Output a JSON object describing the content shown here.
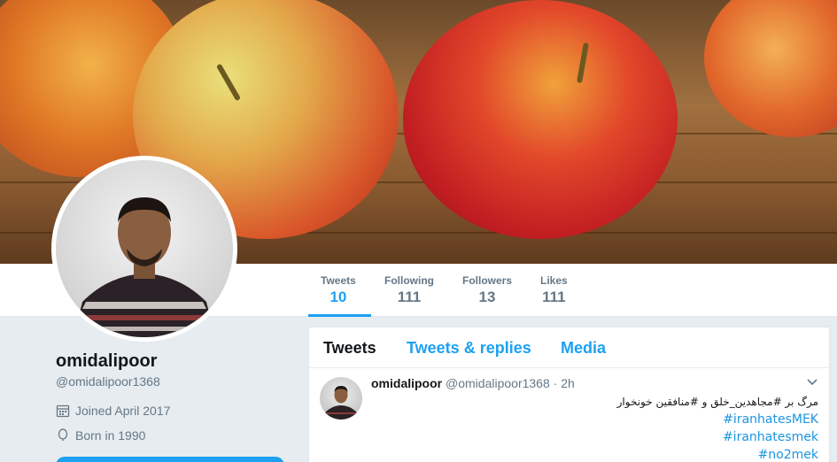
{
  "nav": {
    "tweets_label": "Tweets",
    "tweets_count": "10",
    "following_label": "Following",
    "following_count": "111",
    "followers_label": "Followers",
    "followers_count": "13",
    "likes_label": "Likes",
    "likes_count": "111"
  },
  "profile": {
    "name": "omidalipoor",
    "handle": "@omidalipoor1368",
    "joined": "Joined April 2017",
    "born": "Born in 1990"
  },
  "timeline": {
    "tabs": [
      "Tweets",
      "Tweets & replies",
      "Media"
    ]
  },
  "tweet": {
    "name": "omidalipoor",
    "handle": "@omidalipoor1368",
    "dot": "·",
    "time": "2h",
    "line1": "مرگ بر #مجاهدین_خلق و #منافقین  خونخوار",
    "tags": [
      "#iranhatesMEK",
      "#iranhatesmek",
      "#no2mek"
    ]
  },
  "colors": {
    "accent": "#1da1f2",
    "muted": "#657786",
    "background": "#e6ecf0"
  }
}
